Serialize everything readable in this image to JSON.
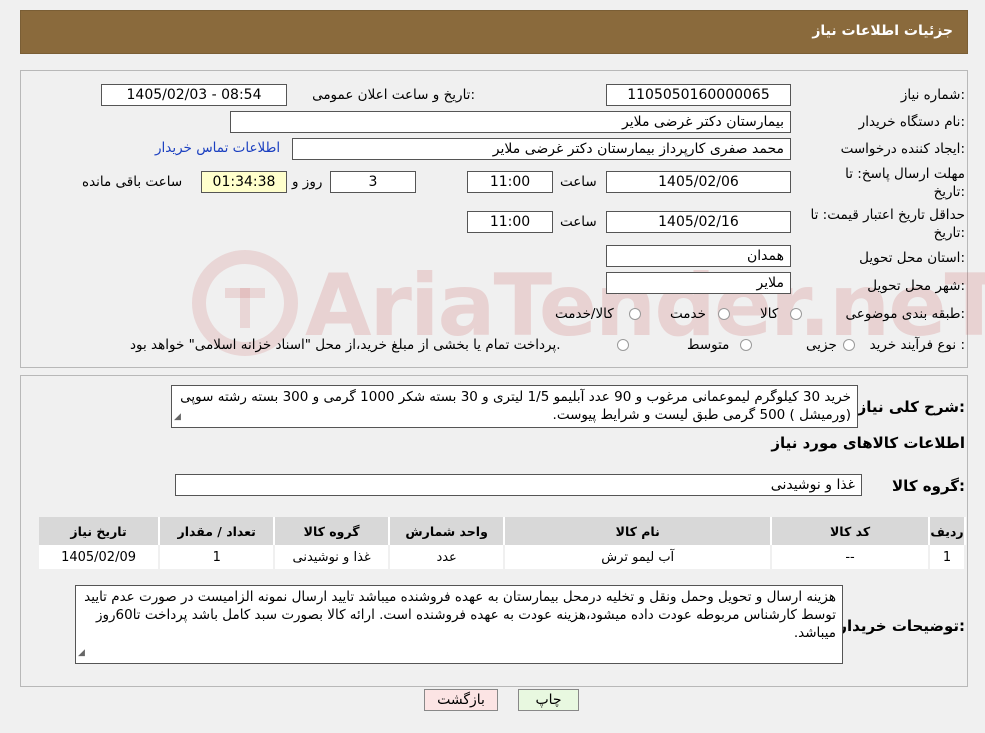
{
  "header": {
    "title": "جزئیات اطلاعات نیاز"
  },
  "form": {
    "need_number_label": "شماره نیاز:",
    "need_number": "1105050160000065",
    "announce_label": "تاریخ و ساعت اعلان عمومی:",
    "announce_value": "1405/02/03 - 08:54",
    "buyer_org_label": "نام دستگاه خریدار:",
    "buyer_org": "بیمارستان دکتر غرضی ملایر",
    "creator_label": "ایجاد کننده درخواست:",
    "creator": "محمد صفری کارپرداز بیمارستان دکتر غرضی ملایر",
    "contact_link": "اطلاعات تماس خریدار",
    "deadline_label_1": "مهلت ارسال پاسخ: تا",
    "deadline_label_2": "تاریخ:",
    "deadline_date": "1405/02/06",
    "time_label": "ساعت",
    "deadline_time": "11:00",
    "days_value": "3",
    "days_label": "روز و",
    "remaining_time": "01:34:38",
    "remaining_label": "ساعت باقی مانده",
    "validity_label_1": "حداقل تاریخ اعتبار قیمت: تا",
    "validity_label_2": "تاریخ:",
    "validity_date": "1405/02/16",
    "validity_time_label": "ساعت",
    "validity_time": "11:00",
    "province_label": "استان محل تحویل:",
    "province": "همدان",
    "city_label": "شهر محل تحویل:",
    "city": "ملایر",
    "category_label": "طبقه بندی موضوعی:",
    "category_options": [
      "کالا",
      "خدمت",
      "کالا/خدمت"
    ],
    "process_label": "نوع فرآیند خرید :",
    "process_options": [
      "جزیی",
      "متوسط"
    ],
    "process_note": "پرداخت تمام یا بخشی از مبلغ خرید،از محل \"اسناد خزانه اسلامی\" خواهد بود."
  },
  "description": {
    "label": "شرح کلی نیاز:",
    "text": "خرید 30 کیلوگرم لیموعمانی مرغوب و 90 عدد آبلیمو 1/5 لیتری  و 30 بسته  شکر 1000 گرمی و 300 بسته رشته سوپی  (ورمیشل ) 500 گرمی طبق لیست و شرایط پیوست."
  },
  "goods": {
    "section_title": "اطلاعات کالاهای مورد نیاز",
    "group_label": "گروه کالا:",
    "group_value": "غذا و نوشیدنی",
    "columns": [
      "ردیف",
      "کد کالا",
      "نام کالا",
      "واحد شمارش",
      "گروه کالا",
      "تعداد / مقدار",
      "تاریخ نیاز"
    ],
    "rows": [
      [
        "1",
        "--",
        "آب لیمو ترش",
        "عدد",
        "غذا و نوشیدنی",
        "1",
        "1405/02/09"
      ]
    ]
  },
  "buyer_notes": {
    "label": "توضیحات خریدار:",
    "text": "هزینه ارسال و تحویل وحمل ونقل و تخلیه درمحل بیمارستان به عهده فروشنده میباشد تایید ارسال نمونه الزامیست در صورت عدم تایید توسط کارشناس مربوطه عودت داده میشود،هزینه عودت به عهده فروشنده است. ارائه کالا  بصورت سبد کامل باشد پرداخت تا60روز میباشد."
  },
  "watermark": {
    "text": "AriaTender.neT"
  },
  "buttons": {
    "print": "چاپ",
    "back": "بازگشت"
  }
}
